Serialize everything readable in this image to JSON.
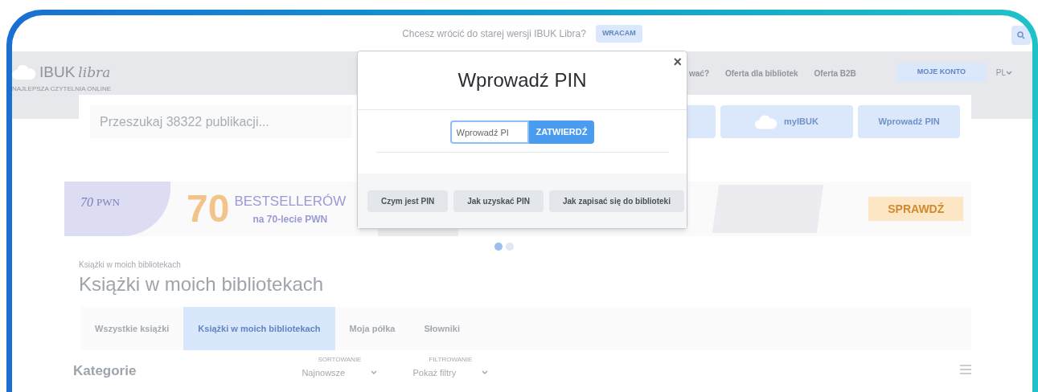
{
  "top_notice": {
    "text": "Chcesz wrócić do starej wersji IBUK Libra?",
    "button": "WRACAM"
  },
  "header": {
    "logo": "IBUK",
    "logo_script": "libra",
    "tagline": "NAJLEPSZA CZYTELNIA ONLINE",
    "nav": [
      "wać?",
      "Oferta dla bibliotek",
      "Oferta B2B"
    ],
    "account_button": "MOJE KONTO",
    "language": "PL"
  },
  "search": {
    "placeholder": "Przeszukaj 38322 publikacji...",
    "tiles": [
      {
        "kind": "blank"
      },
      {
        "kind": "icon",
        "label": "myIBUK"
      },
      {
        "kind": "text",
        "label": "Wprowadź PIN"
      }
    ]
  },
  "banner": {
    "logo_number": "70",
    "logo_brand": "PWN",
    "headline_number": "70",
    "headline": "BESTSELLERÓW",
    "subline": "na 70-lecie PWN",
    "button": "SPRAWDŹ"
  },
  "carousel_dots": [
    {
      "selected": true
    },
    {
      "selected": false
    }
  ],
  "breadcrumb": "Książki w moich bibliotekach",
  "heading": "Książki w moich bibliotekach",
  "tabs": [
    {
      "label": "Wszystkie książki",
      "selected": false
    },
    {
      "label": "Książki w moich bibliotekach",
      "selected": true
    },
    {
      "label": "Moja półka",
      "selected": false
    },
    {
      "label": "Słowniki",
      "selected": false
    }
  ],
  "categories_title": "Kategorie",
  "sort": {
    "label": "SORTOWANIE",
    "value": "Najnowsze"
  },
  "filter": {
    "label": "FILTROWANIE",
    "value": "Pokaż filtry"
  },
  "modal": {
    "title": "Wprowadź PIN",
    "close": "×",
    "pin_placeholder": "Wprowadź PI",
    "submit": "ZATWIERDŹ",
    "footer_buttons": [
      "Czym jest PIN",
      "Jak uzyskać PIN",
      "Jak zapisać się do biblioteki"
    ]
  }
}
